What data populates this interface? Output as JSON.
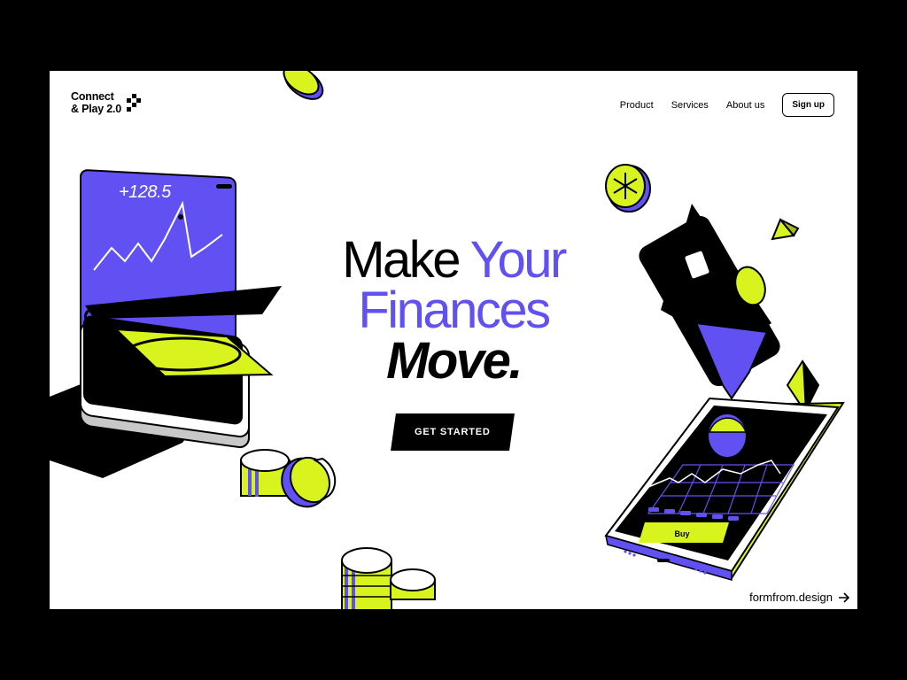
{
  "brand": {
    "line1": "Connect",
    "line2": "& Play 2.0"
  },
  "nav": {
    "items": [
      {
        "label": "Product"
      },
      {
        "label": "Services"
      },
      {
        "label": "About us"
      }
    ],
    "signup_label": "Sign up"
  },
  "hero": {
    "word1": "Make",
    "word2": "Your",
    "word3": "Finances",
    "word4": "Move."
  },
  "cta": {
    "label": "GET STARTED"
  },
  "wallet_card": {
    "value": "+128.5"
  },
  "phone": {
    "buy_label": "Buy"
  },
  "footer": {
    "link_label": "formfrom.design"
  },
  "colors": {
    "accent": "#6151f2",
    "lime": "#d9f31f",
    "black": "#000000",
    "white": "#ffffff"
  }
}
